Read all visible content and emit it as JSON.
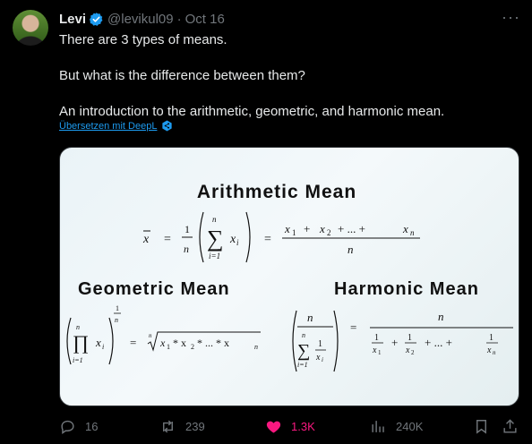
{
  "post": {
    "author_name": "Levi",
    "handle": "@levikul09",
    "separator": "·",
    "date": "Oct 16",
    "more_icon": "more-icon",
    "text_lines": [
      "There are 3 types of means.",
      "But what is the difference between them?",
      "An introduction to the arithmetic, geometric, and harmonic mean."
    ],
    "translate_label": "Übersetzen mit DeepL"
  },
  "media": {
    "arithmetic_title": "Arithmetic Mean",
    "geometric_title": "Geometric Mean",
    "harmonic_title": "Harmonic Mean"
  },
  "actions": {
    "replies": "16",
    "reposts": "239",
    "likes": "1.3K",
    "views": "240K"
  },
  "colors": {
    "background": "#000000",
    "text": "#e7e9ea",
    "muted": "#71767b",
    "link": "#1d9bf0",
    "like": "#f91880",
    "verified": "#1d9bf0"
  }
}
